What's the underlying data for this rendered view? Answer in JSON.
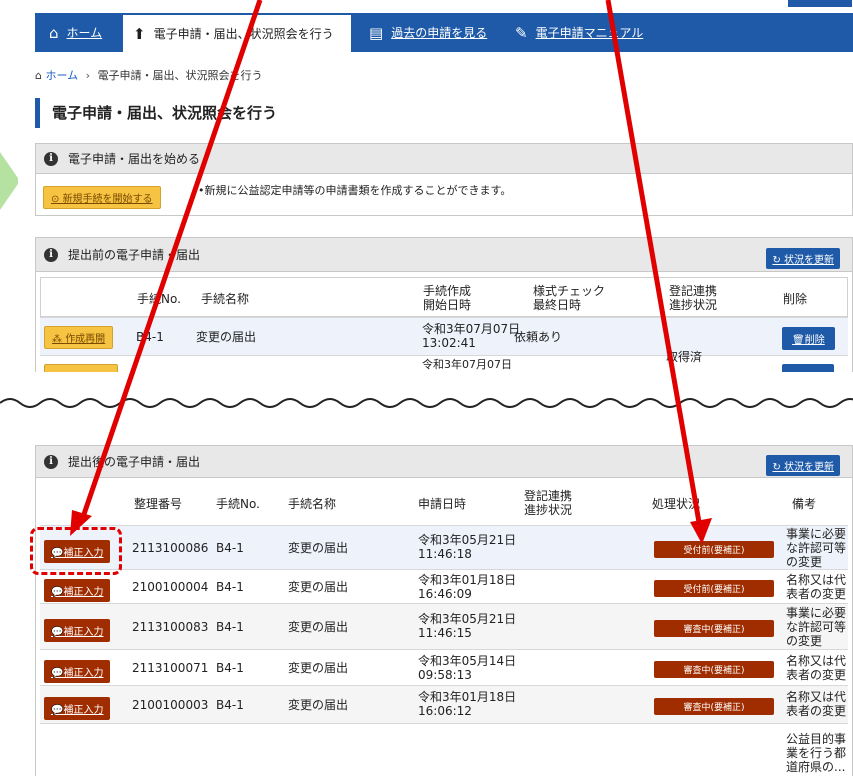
{
  "nav": {
    "items": [
      {
        "label": "ホーム",
        "icon": "home-icon"
      },
      {
        "label": "電子申請・届出、状況照会を行う",
        "icon": "upload-icon"
      },
      {
        "label": "過去の申請を見る",
        "icon": "document-icon"
      },
      {
        "label": "電子申請マニュアル",
        "icon": "edit-icon"
      }
    ]
  },
  "breadcrumb": {
    "home": "ホーム",
    "current": "電子申請・届出、状況照会を行う"
  },
  "page_title": "電子申請・届出、状況照会を行う",
  "start_panel": {
    "title": "電子申請・届出を始める",
    "button": "新規手続を開始する",
    "note": "•新規に公益認定申請等の申請書類を作成することができます。"
  },
  "pre_panel": {
    "title": "提出前の電子申請・届出",
    "refresh": "状況を更新",
    "headers": {
      "no": "手続No.",
      "name": "手続名称",
      "created_1": "手続作成",
      "created_2": "開始日時",
      "check_1": "様式チェック",
      "check_2": "最終日時",
      "reg_1": "登記連携",
      "reg_2": "進捗状況",
      "delete": "削除"
    },
    "rows": [
      {
        "action": "作成再開",
        "no": "B4-1",
        "name": "変更の届出",
        "date": "令和3年07月07日",
        "time": "13:02:41",
        "check": "依頼あり",
        "reg": "",
        "delete": "削除"
      }
    ],
    "partial_row": {
      "date": "令和3年07月07日",
      "reg": "取得済"
    }
  },
  "post_panel": {
    "title": "提出後の電子申請・届出",
    "refresh": "状況を更新",
    "headers": {
      "seq": "整理番号",
      "no": "手続No.",
      "name": "手続名称",
      "date": "申請日時",
      "reg_1": "登記連携",
      "reg_2": "進捗状況",
      "status": "処理状況",
      "remark": "備考"
    },
    "rows": [
      {
        "action": "補正入力",
        "seq": "2113100086",
        "no": "B4-1",
        "name": "変更の届出",
        "date": "令和3年05月21日",
        "time": "11:46:18",
        "status": "受付前(要補正)",
        "remark": [
          "事業に必要",
          "な許認可等",
          "の変更"
        ]
      },
      {
        "action": "補正入力",
        "seq": "2100100004",
        "no": "B4-1",
        "name": "変更の届出",
        "date": "令和3年01月18日",
        "time": "16:46:09",
        "status": "受付前(要補正)",
        "remark": [
          "名称又は代",
          "表者の変更"
        ]
      },
      {
        "action": "補正入力",
        "seq": "2113100083",
        "no": "B4-1",
        "name": "変更の届出",
        "date": "令和3年05月21日",
        "time": "11:46:15",
        "status": "審査中(要補正)",
        "remark": [
          "事業に必要",
          "な許認可等",
          "の変更"
        ]
      },
      {
        "action": "補正入力",
        "seq": "2113100071",
        "no": "B4-1",
        "name": "変更の届出",
        "date": "令和3年05月14日",
        "time": "09:58:13",
        "status": "審査中(要補正)",
        "remark": [
          "名称又は代",
          "表者の変更"
        ]
      },
      {
        "action": "補正入力",
        "seq": "2100100003",
        "no": "B4-1",
        "name": "変更の届出",
        "date": "令和3年01月18日",
        "time": "16:06:12",
        "status": "審査中(要補正)",
        "remark": [
          "名称又は代",
          "表者の変更"
        ]
      }
    ],
    "trailing_remark": [
      "公益目的事",
      "業を行う都",
      "道府県の..."
    ]
  },
  "colors": {
    "primary": "#1e5aa8",
    "accent_yellow": "#f6c342",
    "status_brown": "#a02d00",
    "annotation_red": "#e00000"
  }
}
